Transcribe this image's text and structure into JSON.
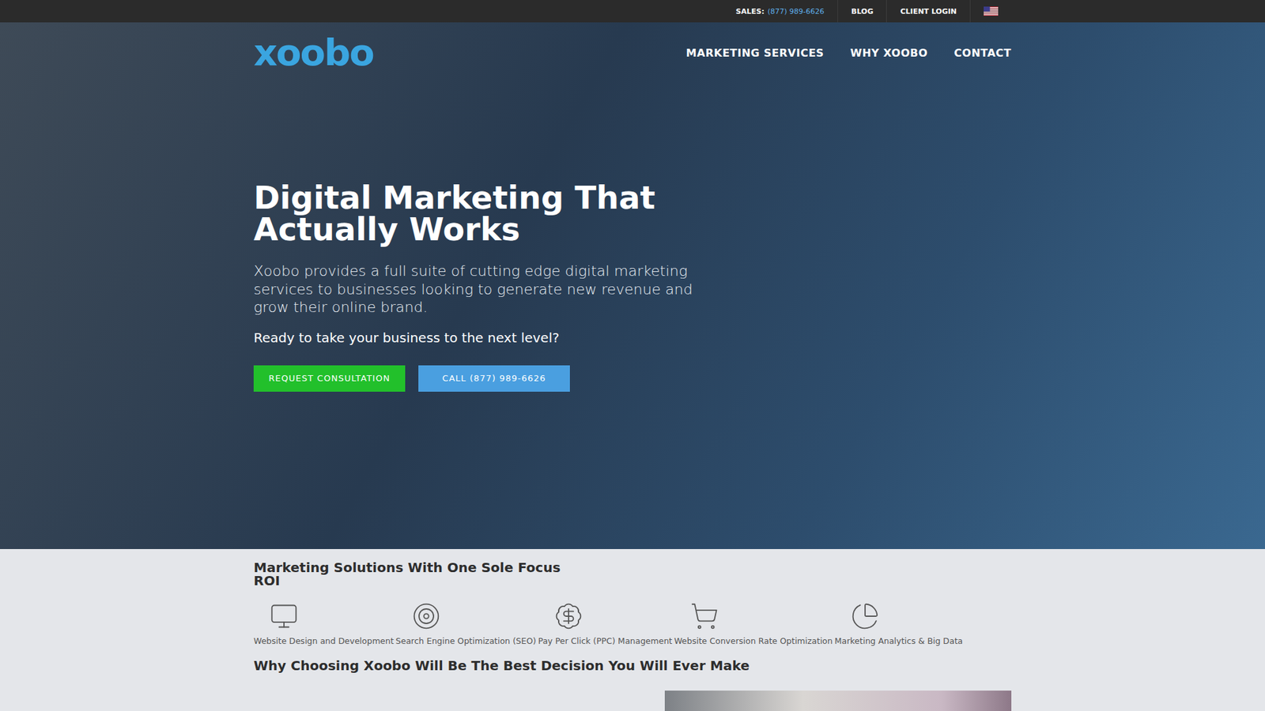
{
  "topbar": {
    "sales_label": "SALES:",
    "sales_phone": "(877) 989-6626",
    "links": [
      "BLOG",
      "CLIENT LOGIN"
    ]
  },
  "logo": "xoobo",
  "nav": [
    "MARKETING SERVICES",
    "WHY XOOBO",
    "CONTACT"
  ],
  "hero": {
    "title": "Digital Marketing That Actually Works",
    "subtitle": "Xoobo provides a full suite of cutting edge digital marketing services to businesses looking to generate new revenue and grow their online brand.",
    "prompt": "Ready to take your business to the next level?",
    "buttons": [
      {
        "label": "REQUEST CONSULTATION",
        "color": "#22c02b"
      },
      {
        "label": "CALL (877) 989-6626",
        "color": "#4a9fe0"
      }
    ]
  },
  "solutions": {
    "title": "Marketing Solutions With One Sole Focus",
    "subtitle": "ROI",
    "items": [
      "Website Design and Development",
      "Search Engine Optimization (SEO)",
      "Pay Per Click (PPC) Management",
      "Website Conversion Rate Optimization",
      "Marketing Analytics & Big Data"
    ]
  },
  "why": {
    "title": "Why Choosing Xoobo Will Be The Best Decision You Will Ever Make"
  }
}
